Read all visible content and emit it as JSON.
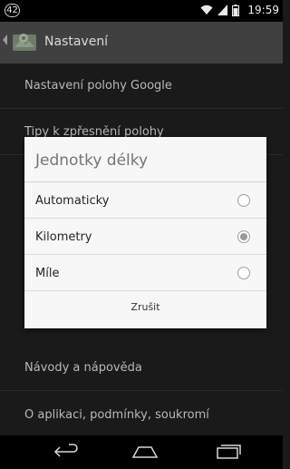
{
  "status_bar": {
    "notification_count": "42",
    "time": "19:59",
    "icons": [
      "wifi-icon",
      "signal-icon",
      "battery-icon"
    ]
  },
  "app_bar": {
    "title": "Nastavení",
    "icon": "location-settings-icon"
  },
  "settings": {
    "items": [
      "Nastavení polohy Google",
      "Tipy k zpřesnění polohy",
      "Návody a nápověda",
      "O aplikaci, podmínky, soukromí"
    ]
  },
  "dialog": {
    "title": "Jednotky délky",
    "options": [
      {
        "label": "Automaticky",
        "selected": false
      },
      {
        "label": "Kilometry",
        "selected": true
      },
      {
        "label": "Míle",
        "selected": false
      }
    ],
    "cancel_label": "Zrušit"
  },
  "nav_bar": {
    "icons": [
      "back-icon",
      "home-icon",
      "recent-apps-icon"
    ]
  },
  "colors": {
    "background": "#1a1a1a",
    "app_bar": "#404040",
    "dialog": "#f7f7f7"
  }
}
